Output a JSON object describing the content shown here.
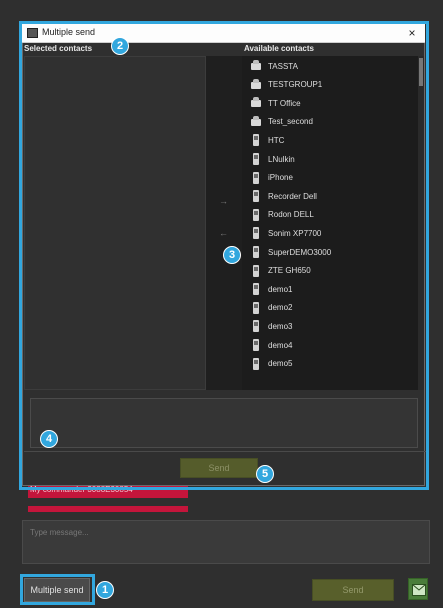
{
  "app": {
    "background_message": "My commander 3088E30854",
    "input_placeholder": "Type message...",
    "send_label": "Send",
    "multiple_send_label": "Multiple send"
  },
  "dialog": {
    "title": "Multiple send",
    "close_glyph": "×",
    "selected_header": "Selected contacts",
    "available_header": "Available contacts",
    "arrow_add": "→",
    "arrow_remove": "←",
    "send_label": "Send",
    "available_contacts": [
      {
        "name": "TASSTA",
        "type": "group"
      },
      {
        "name": "TESTGROUP1",
        "type": "group"
      },
      {
        "name": "TT Office",
        "type": "group"
      },
      {
        "name": "Test_second",
        "type": "group"
      },
      {
        "name": "HTC",
        "type": "device"
      },
      {
        "name": "LNulkin",
        "type": "device"
      },
      {
        "name": "iPhone",
        "type": "device"
      },
      {
        "name": "Recorder Dell",
        "type": "device"
      },
      {
        "name": "Rodon DELL",
        "type": "device"
      },
      {
        "name": "Sonim XP7700",
        "type": "device"
      },
      {
        "name": "SuperDEMO3000",
        "type": "device"
      },
      {
        "name": "ZTE GH650",
        "type": "device"
      },
      {
        "name": "demo1",
        "type": "device"
      },
      {
        "name": "demo2",
        "type": "device"
      },
      {
        "name": "demo3",
        "type": "device"
      },
      {
        "name": "demo4",
        "type": "device"
      },
      {
        "name": "demo5",
        "type": "device"
      }
    ]
  },
  "callouts": [
    "1",
    "2",
    "3",
    "4",
    "5"
  ],
  "colors": {
    "callout": "#32a7de",
    "send_button": "#6f7b2a",
    "alert_strip": "#c4153b"
  }
}
